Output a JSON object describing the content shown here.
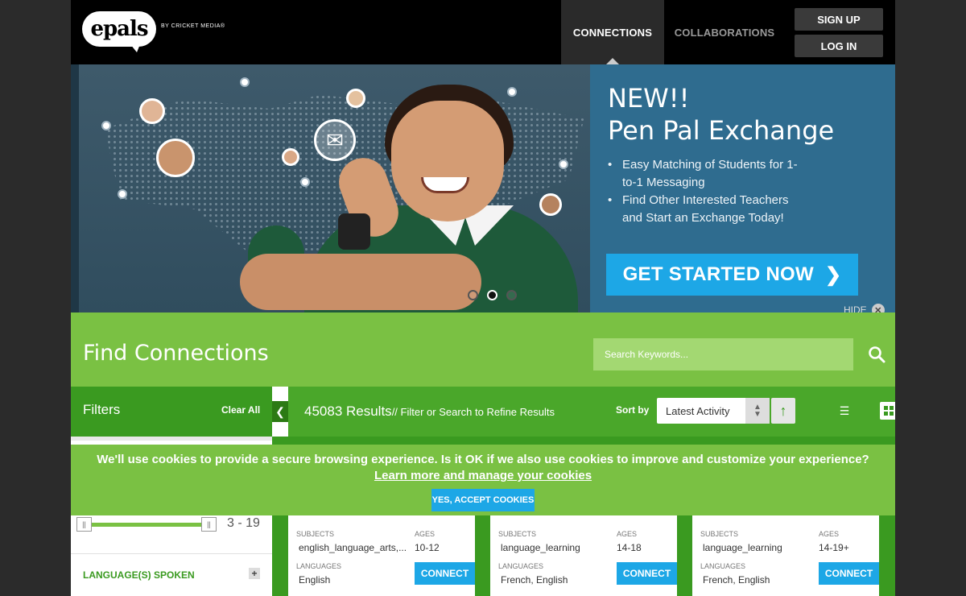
{
  "header": {
    "logo_text": "epals",
    "logo_byline": "BY CRICKET MEDIA®",
    "nav": [
      {
        "label": "CONNECTIONS",
        "active": true
      },
      {
        "label": "COLLABORATIONS",
        "active": false
      }
    ],
    "signup_label": "SIGN UP",
    "login_label": "LOG IN"
  },
  "hero": {
    "promo_title_line1": "NEW!!",
    "promo_title_line2": "Pen Pal Exchange",
    "bullets": [
      "Easy Matching of Students for 1-to-1 Messaging",
      "Find Other Interested Teachers and Start an Exchange Today!"
    ],
    "cta_label": "GET STARTED NOW",
    "hide_label": "HIDE",
    "carousel": {
      "count": 3,
      "active_index": 1
    }
  },
  "find": {
    "title": "Find Connections",
    "search_placeholder": "Search Keywords..."
  },
  "filters": {
    "title": "Filters",
    "clear_all": "Clear All",
    "age_range": "3 - 19",
    "language_filter": "LANGUAGE(S) SPOKEN"
  },
  "results": {
    "count": "45083 Results",
    "hint": "// Filter or Search to Refine Results",
    "sort_label": "Sort by",
    "sort_value": "Latest Activity"
  },
  "cards": [
    {
      "subjects": "english_language_arts,...",
      "ages": "10-12",
      "languages": "English",
      "connect": "CONNECT"
    },
    {
      "subjects": "language_learning",
      "ages": "14-18",
      "languages": "French, English",
      "connect": "CONNECT"
    },
    {
      "subjects": "language_learning",
      "ages": "14-19+",
      "languages": "French, English",
      "connect": "CONNECT"
    }
  ],
  "card_labels": {
    "subjects": "SUBJECTS",
    "ages": "AGES",
    "languages": "LANGUAGES"
  },
  "cookie": {
    "message": "We'll use cookies to provide a secure browsing experience. Is it OK if we also use cookies to improve and customize your experience?",
    "link": "Learn more and manage your cookies",
    "accept": "YES, ACCEPT COOKIES"
  },
  "colors": {
    "brand_green": "#7ac143",
    "dark_green": "#3a9a20",
    "accent_blue": "#1da7e6",
    "promo_blue": "#2f6c8f"
  }
}
